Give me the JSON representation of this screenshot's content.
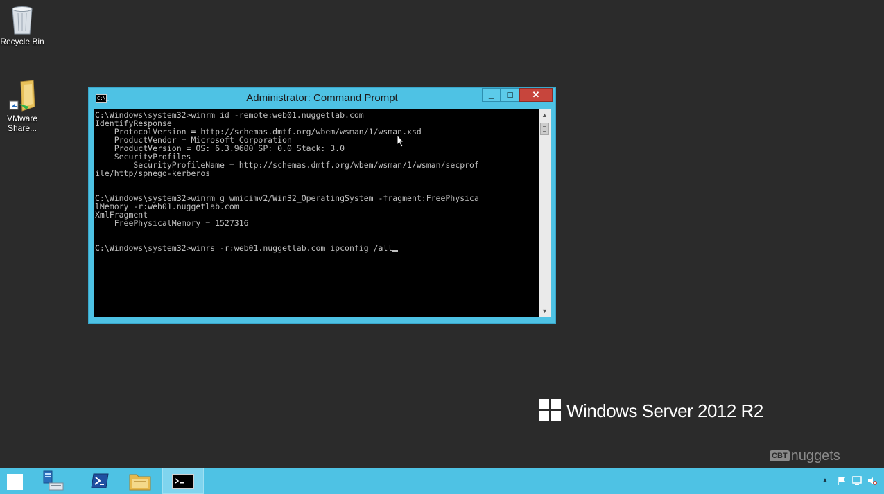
{
  "desktop": {
    "icons": [
      {
        "label": "Recycle Bin"
      },
      {
        "label": "VMware Share..."
      }
    ]
  },
  "window": {
    "title": "Administrator: Command Prompt",
    "system_icon_text": "C:\\_",
    "minimize_glyph": "_",
    "maximize_glyph": "□",
    "close_glyph": "✕",
    "console_lines": [
      "C:\\Windows\\system32>winrm id -remote:web01.nuggetlab.com",
      "IdentifyResponse",
      "    ProtocolVersion = http://schemas.dmtf.org/wbem/wsman/1/wsman.xsd",
      "    ProductVendor = Microsoft Corporation",
      "    ProductVersion = OS: 6.3.9600 SP: 0.0 Stack: 3.0",
      "    SecurityProfiles",
      "        SecurityProfileName = http://schemas.dmtf.org/wbem/wsman/1/wsman/secprof",
      "ile/http/spnego-kerberos",
      "",
      "",
      "C:\\Windows\\system32>winrm g wmicimv2/Win32_OperatingSystem -fragment:FreePhysica",
      "lMemory -r:web01.nuggetlab.com",
      "XmlFragment",
      "    FreePhysicalMemory = 1527316",
      "",
      "",
      "C:\\Windows\\system32>winrs -r:web01.nuggetlab.com ipconfig /all"
    ]
  },
  "branding": {
    "os_name": "Windows Server 2012 R2",
    "watermark_box": "CBT",
    "watermark_text": "nuggets"
  },
  "colors": {
    "desktop": "#2b2b2b",
    "accent": "#4ec2e4",
    "console_bg": "#000000",
    "console_fg": "#c0c0c0",
    "close": "#c7453c"
  }
}
